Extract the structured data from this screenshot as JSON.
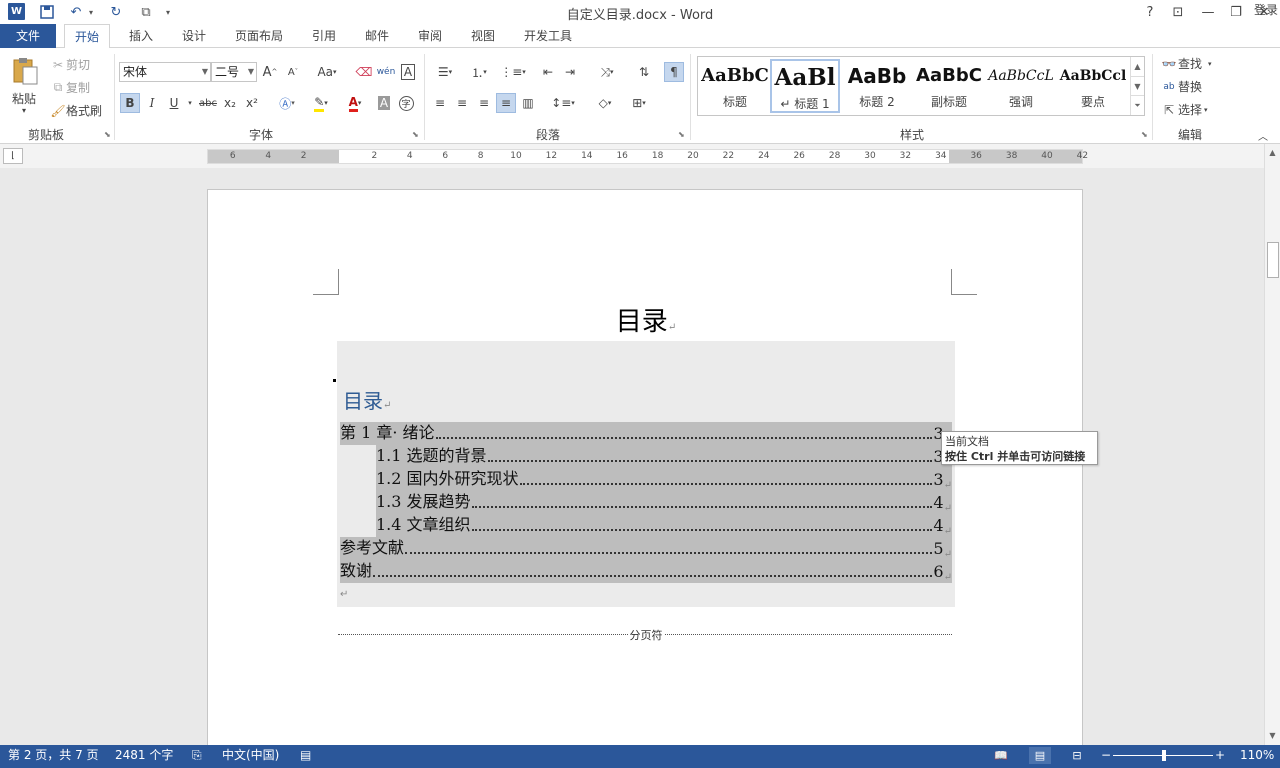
{
  "window": {
    "title": "自定义目录.docx - Word",
    "help": "?",
    "login": "登录"
  },
  "tabs": [
    "文件",
    "开始",
    "插入",
    "设计",
    "页面布局",
    "引用",
    "邮件",
    "审阅",
    "视图",
    "开发工具"
  ],
  "clipboard": {
    "paste": "粘贴",
    "cut": "剪切",
    "copy": "复制",
    "format_painter": "格式刷",
    "group": "剪贴板"
  },
  "font": {
    "name": "宋体",
    "size": "二号",
    "group": "字体",
    "bold": "B",
    "italic": "I",
    "underline": "U",
    "strike": "abc",
    "sub": "x₂",
    "sup": "x²",
    "case": "Aa",
    "grow": "A",
    "shrink": "A",
    "phonetic": "wén",
    "border_char": "A",
    "font_color": "A",
    "shade": "A",
    "enclose": "字"
  },
  "paragraph": {
    "group": "段落"
  },
  "styles": {
    "group": "样式",
    "items": [
      {
        "sample": "AaBbC",
        "name": "标题"
      },
      {
        "sample": "AaBl",
        "name": "↵ 标题 1"
      },
      {
        "sample": "AaBb",
        "name": "标题 2"
      },
      {
        "sample": "AaBbC",
        "name": "副标题"
      },
      {
        "sample": "AaBbCcL",
        "name": "强调"
      },
      {
        "sample": "AaBbCcl",
        "name": "要点"
      }
    ]
  },
  "editing": {
    "group": "编辑",
    "find": "查找",
    "replace": "替换",
    "select": "选择"
  },
  "ruler": {
    "numbers": [
      "6",
      "4",
      "2",
      "2",
      "4",
      "6",
      "8",
      "10",
      "12",
      "14",
      "16",
      "18",
      "20",
      "22",
      "24",
      "26",
      "28",
      "30",
      "32",
      "34",
      "36",
      "38",
      "40",
      "42"
    ]
  },
  "document": {
    "heading": "目录",
    "para_mark": "↵",
    "toc_title": "目录",
    "toc_entries": [
      {
        "text": "第 1 章· 绪论",
        "page": "3",
        "level": 1
      },
      {
        "text": "1.1 选题的背景",
        "page": "3",
        "level": 2
      },
      {
        "text": "1.2 国内外研究现状",
        "page": "3",
        "level": 2
      },
      {
        "text": "1.3 发展趋势",
        "page": "4",
        "level": 2
      },
      {
        "text": "1.4 文章组织",
        "page": "4",
        "level": 2
      },
      {
        "text": "参考文献",
        "page": "5",
        "level": 1
      },
      {
        "text": "致谢",
        "page": "6",
        "level": 1
      }
    ],
    "page_break": "分页符",
    "tooltip_line1": "当前文档",
    "tooltip_line2_bold": "按住 Ctrl",
    "tooltip_line2_rest": " 并单击可访问链接"
  },
  "statusbar": {
    "page": "第 2 页，共 7 页",
    "words": "2481 个字",
    "language": "中文(中国)",
    "zoom": "110%",
    "zoom_level_percent": 110
  }
}
